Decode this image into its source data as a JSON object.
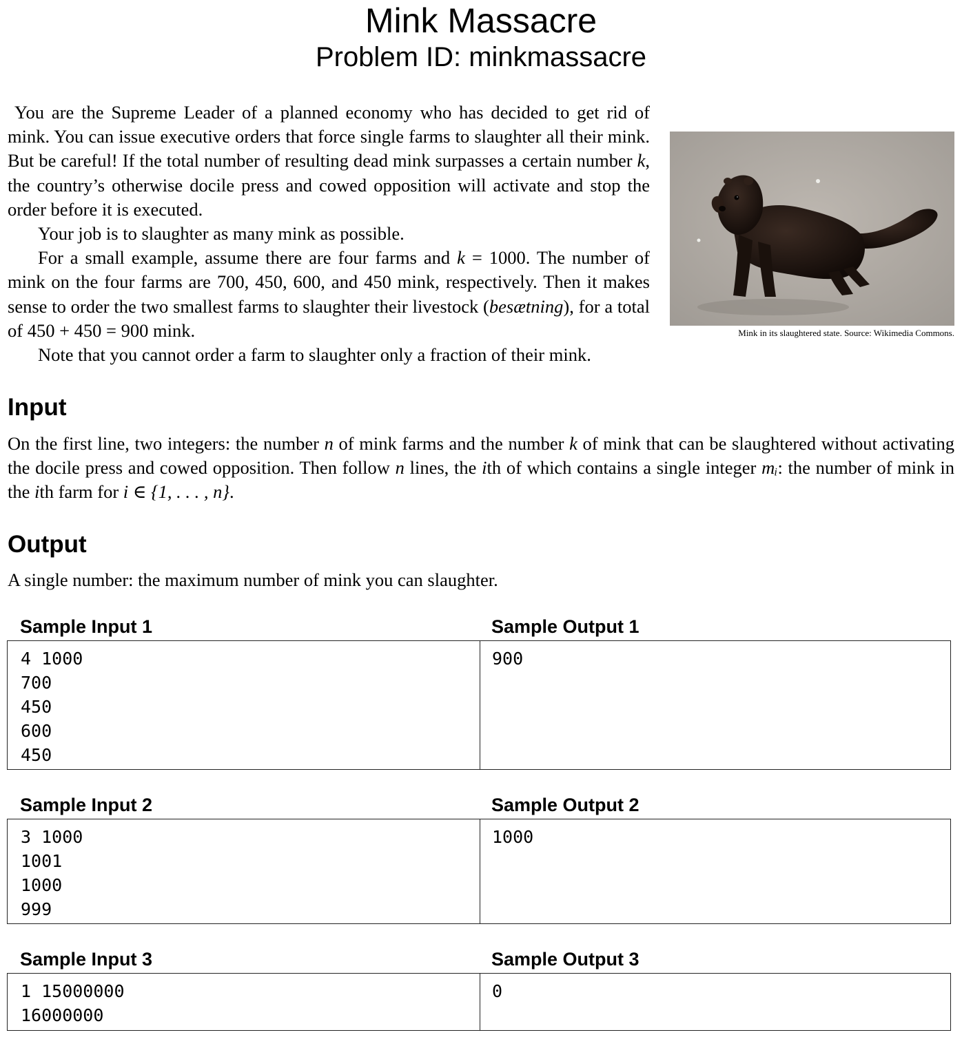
{
  "header": {
    "title": "Mink Massacre",
    "problem_id": "Problem ID: minkmassacre"
  },
  "statement": {
    "p1": "You are the Supreme Leader of a planned economy who has decided to get rid of mink. You can issue executive orders that force single farms to slaughter all their mink. But be careful! If the total number of resulting dead mink surpasses a certain number ",
    "p1_var": "k",
    "p1_end": ", the country’s otherwise docile press and cowed opposition will activate and stop the order before it is executed.",
    "p2": "Your job is to slaughter as many mink as possible.",
    "p3a": "For a small example, assume there are four farms and ",
    "p3_var": "k",
    "p3b": " = 1000. The number of mink on the four farms are 700, 450, 600, and 450 mink, respectively. Then it makes sense to order the two smallest farms to slaughter their livestock (",
    "p3_italic": "besætning",
    "p3c": "), for a total of 450 + 450 = 900 mink.",
    "p4": "Note that you cannot order a farm to slaughter only a fraction of their mink."
  },
  "figure": {
    "caption": "Mink in its slaughtered state. Source: Wikimedia Commons."
  },
  "input": {
    "heading": "Input",
    "t1": "On the first line, two integers: the number ",
    "v_n": "n",
    "t2": " of mink farms and the number ",
    "v_k": "k",
    "t3": " of mink that can be slaughtered without activating the docile press and cowed opposition. Then follow ",
    "v_n2": "n",
    "t4": " lines, the ",
    "v_i": "i",
    "t5": "th of which contains a single integer ",
    "v_mi": "mᵢ",
    "t6": ": the number of mink in the ",
    "v_i2": "i",
    "t7": "th farm for ",
    "v_set": "i ∈ {1, . . . , n}",
    "t8": "."
  },
  "output": {
    "heading": "Output",
    "text": "A single number: the maximum number of mink you can slaughter."
  },
  "samples": [
    {
      "input_label": "Sample Input 1",
      "output_label": "Sample Output 1",
      "input_lines": [
        "4 1000",
        "700",
        "450",
        "600",
        "450"
      ],
      "output_lines": [
        "900"
      ]
    },
    {
      "input_label": "Sample Input 2",
      "output_label": "Sample Output 2",
      "input_lines": [
        "3 1000",
        "1001",
        "1000",
        "999"
      ],
      "output_lines": [
        "1000"
      ]
    },
    {
      "input_label": "Sample Input 3",
      "output_label": "Sample Output 3",
      "input_lines": [
        "1 15000000",
        "16000000"
      ],
      "output_lines": [
        "0"
      ]
    }
  ]
}
